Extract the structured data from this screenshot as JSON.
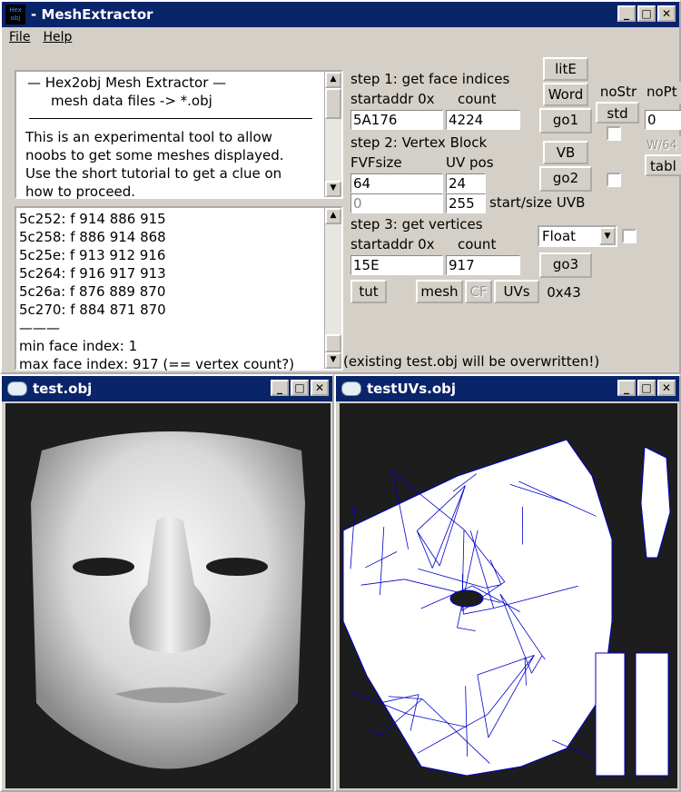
{
  "main_window": {
    "title": "- MeshExtractor",
    "app_icon_text": "Hex obj",
    "menu": [
      "File",
      "Help"
    ]
  },
  "info_text": {
    "header1": "—   Hex2obj Mesh Extractor   —",
    "header2": "mesh data files -> *.obj",
    "body": "This is an experimental tool to allow noobs to get some meshes displayed. Use the short tutorial to get a clue on how to proceed."
  },
  "output_list": {
    "lines": [
      "5c252: f  914 886 915",
      "5c258: f  886 914 868",
      "5c25e: f  913 912 916",
      "5c264: f  916 917 913",
      "5c26a: f  876 889 870",
      "5c270: f  884 871 870",
      "———",
      "min face index: 1",
      "max face index: 917 (== vertex count?)"
    ]
  },
  "step1": {
    "title": "step 1: get face indices",
    "startaddr_label": "startaddr 0x",
    "count_label": "count",
    "startaddr_value": "5A176",
    "count_value": "4224"
  },
  "step2": {
    "title": "step 2: Vertex Block",
    "fvf_label": "FVFsize",
    "uvpos_label": "UV pos",
    "fvf_value": "64",
    "uvpos_value": "24",
    "uvb_start_value": "0",
    "uvb_size_value": "255",
    "uvb_label": "start/size UVB"
  },
  "step3": {
    "title": "step 3: get vertices",
    "startaddr_label": "startaddr 0x",
    "count_label": "count",
    "startaddr_value": "15E",
    "count_value": "917",
    "type_value": "Float"
  },
  "buttons": {
    "lite": "litE",
    "word": "Word",
    "nostr": "noStr",
    "nopt": "noPt",
    "go1": "go1",
    "std": "std",
    "vb": "VB",
    "w64": "W/64",
    "go2": "go2",
    "tabl": "tabl",
    "go3": "go3",
    "tut": "tut",
    "mesh": "mesh",
    "cf": "CF",
    "uvs": "UVs",
    "hex43": "0x43"
  },
  "side_field_value": "0",
  "status_text": "(existing test.obj will be overwritten!)",
  "test_window": {
    "title": "test.obj"
  },
  "uv_window": {
    "title": "testUVs.obj"
  },
  "colors": {
    "titlebar": "#0a246a",
    "face_bg": "#d4d0c8",
    "uv_wire": "#0000cc"
  }
}
